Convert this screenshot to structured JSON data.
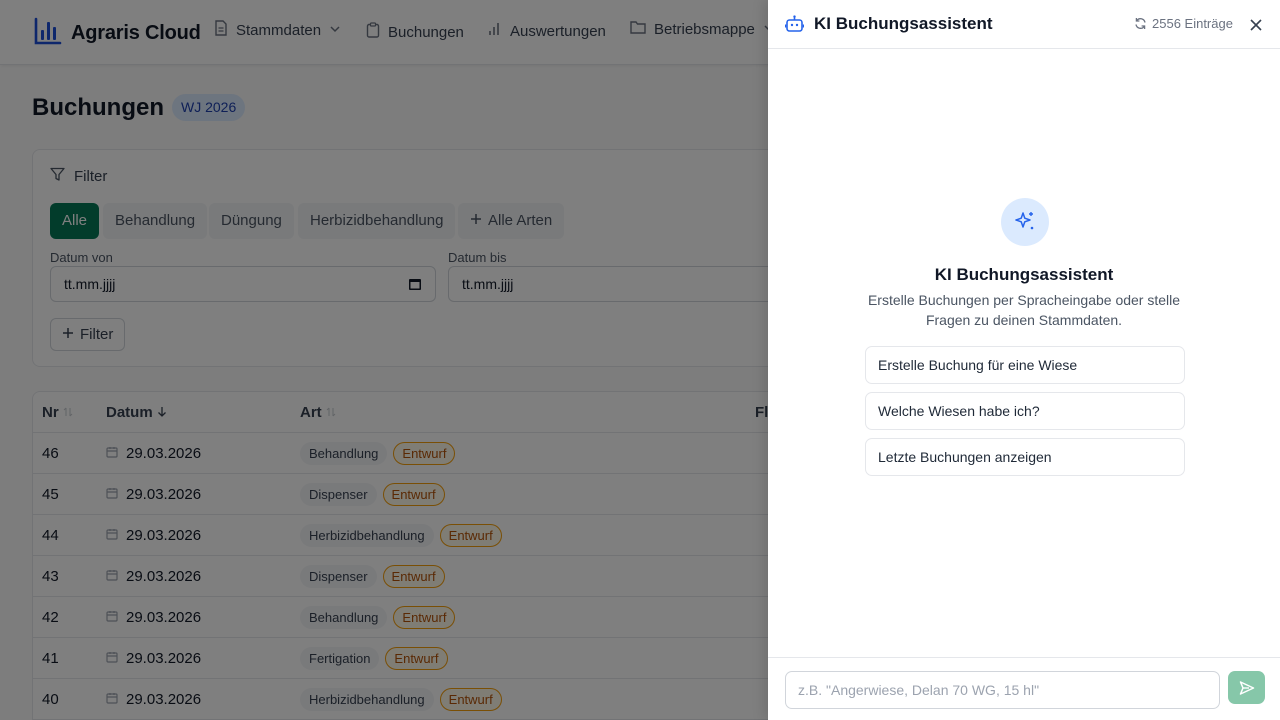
{
  "header": {
    "brand": "Agraris Cloud",
    "nav": [
      {
        "label": "Stammdaten",
        "icon": "document-icon",
        "has_dropdown": true
      },
      {
        "label": "Buchungen",
        "icon": "clipboard-icon"
      },
      {
        "label": "Auswertungen",
        "icon": "bar-chart-icon"
      },
      {
        "label": "Betriebsmappe",
        "icon": "folder-icon",
        "has_dropdown": true
      }
    ]
  },
  "page": {
    "title": "Buchungen",
    "year_badge": "WJ 2026"
  },
  "filter": {
    "heading": "Filter",
    "chips": [
      "Alle",
      "Behandlung",
      "Düngung",
      "Herbizidbehandlung"
    ],
    "all_types_label": "Alle Arten",
    "active_chip": "Alle",
    "date_from_label": "Datum von",
    "date_to_label": "Datum bis",
    "date_placeholder": "tt.mm.jjjj",
    "add_filter_label": "Filter"
  },
  "table": {
    "columns": [
      "Nr",
      "Datum",
      "Art",
      "Fl"
    ],
    "rows": [
      {
        "nr": "46",
        "date": "29.03.2026",
        "art": "Behandlung",
        "status": "Entwurf"
      },
      {
        "nr": "45",
        "date": "29.03.2026",
        "art": "Dispenser",
        "status": "Entwurf"
      },
      {
        "nr": "44",
        "date": "29.03.2026",
        "art": "Herbizidbehandlung",
        "status": "Entwurf"
      },
      {
        "nr": "43",
        "date": "29.03.2026",
        "art": "Dispenser",
        "status": "Entwurf"
      },
      {
        "nr": "42",
        "date": "29.03.2026",
        "art": "Behandlung",
        "status": "Entwurf"
      },
      {
        "nr": "41",
        "date": "29.03.2026",
        "art": "Fertigation",
        "status": "Entwurf"
      },
      {
        "nr": "40",
        "date": "29.03.2026",
        "art": "Herbizidbehandlung",
        "status": "Entwurf"
      }
    ]
  },
  "assistant": {
    "title": "KI Buchungsassistent",
    "entries": "2556 Einträge",
    "welcome_title": "KI Buchungsassistent",
    "welcome_text": "Erstelle Buchungen per Spracheingabe oder stelle Fragen zu deinen Stammdaten.",
    "suggestions": [
      "Erstelle Buchung für eine Wiese",
      "Welche Wiesen habe ich?",
      "Letzte Buchungen anzeigen"
    ],
    "input_placeholder": "z.B. \"Angerwiese, Delan 70 WG, 15 hl\""
  },
  "colors": {
    "accent_green": "#047857",
    "send_button": "#86c7a9",
    "badge_blue_bg": "#dbeafe",
    "status_amber": "#f59e0b"
  }
}
